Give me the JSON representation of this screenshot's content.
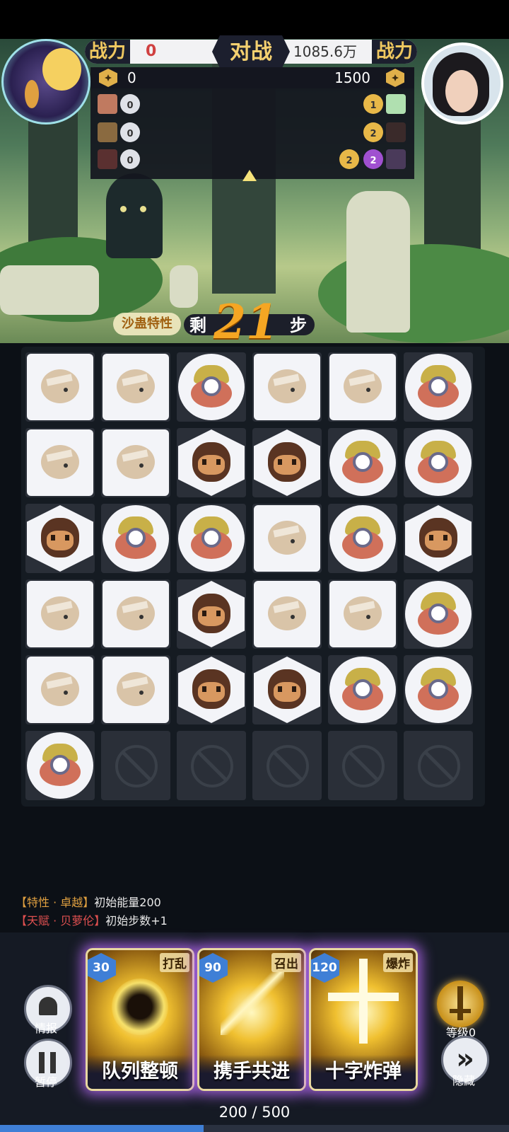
{
  "header": {
    "left_power_label": "战力",
    "left_power_value": "0",
    "vs_label": "对战",
    "right_power_value": "1085.6万",
    "right_power_label": "战力",
    "left_energy": "0",
    "right_energy": "1500"
  },
  "enemy_team": {
    "left_counts": [
      "0",
      "0",
      "0"
    ],
    "right_rows": [
      [
        "1"
      ],
      [
        "2"
      ],
      [
        "2",
        "2"
      ]
    ]
  },
  "steps": {
    "trait_label": "沙蛊特性",
    "prefix": "剩",
    "count": "21",
    "suffix": "步"
  },
  "board": {
    "rows": [
      [
        "blank",
        "blank",
        "cyclops",
        "blank",
        "blank",
        "cyclops"
      ],
      [
        "blank",
        "blank",
        "monkey",
        "monkey",
        "cyclops",
        "cyclops"
      ],
      [
        "monkey",
        "cyclops",
        "cyclops",
        "blank",
        "cyclops",
        "monkey"
      ],
      [
        "blank",
        "blank",
        "monkey",
        "blank",
        "blank",
        "cyclops"
      ],
      [
        "blank",
        "blank",
        "monkey",
        "monkey",
        "cyclops",
        "cyclops"
      ],
      [
        "cyclops",
        "blocked",
        "blocked",
        "blocked",
        "blocked",
        "blocked"
      ]
    ]
  },
  "info_lines": {
    "trait_tag": "【特性 · 卓越】",
    "trait_text": "初始能量200",
    "talent_tag": "【天赋 · 贝萝伦】",
    "talent_text": "初始步数+1"
  },
  "cards": [
    {
      "name": "队列整顿",
      "cost": "30",
      "tag": "打乱"
    },
    {
      "name": "携手共进",
      "cost": "90",
      "tag": "召出"
    },
    {
      "name": "十字炸弹",
      "cost": "120",
      "tag": "爆炸"
    }
  ],
  "side_buttons": {
    "intel": "情报",
    "pause": "暂停",
    "level": "等级0",
    "hide": "隐藏"
  },
  "energy_bar": {
    "text": "200 / 500",
    "fraction": 0.4
  },
  "colors": {
    "accent_gold": "#f0c860",
    "power_red": "#d04040",
    "card_glow": "#be6eff",
    "cost_blue": "#3f7fd6"
  }
}
